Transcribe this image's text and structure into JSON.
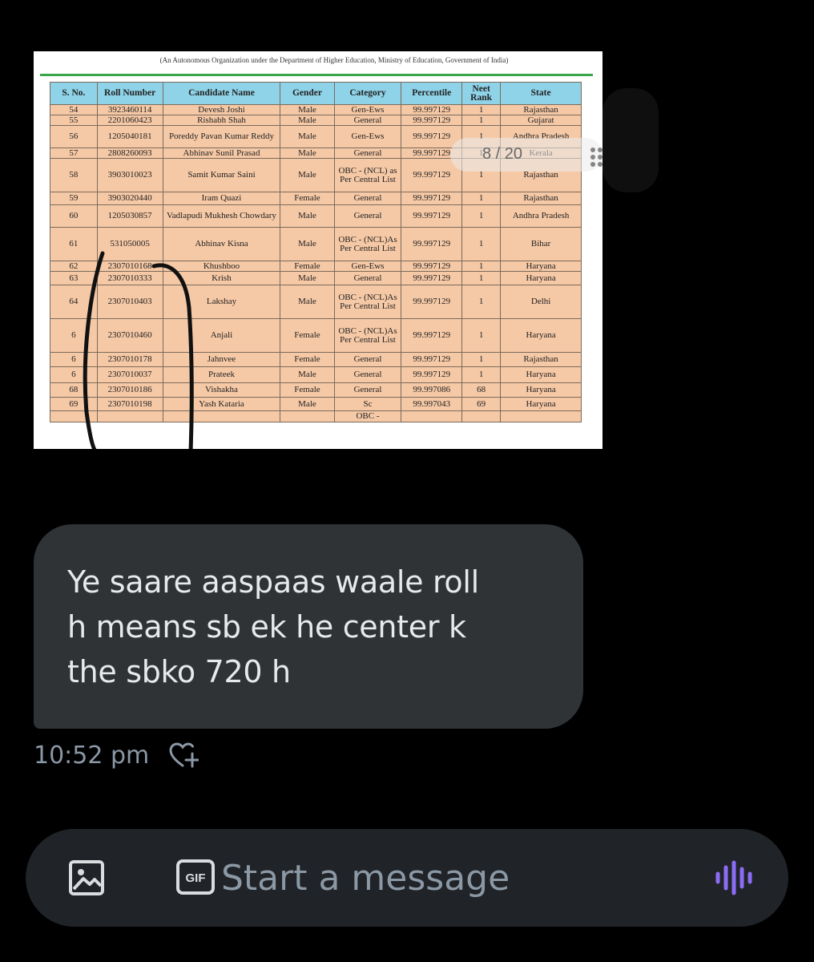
{
  "attachment": {
    "header_text": "(An Autonomous Organization under the Department of Higher Education, Ministry of Education, Government of India)",
    "pager": "8 / 20",
    "table": {
      "headers": [
        "S. No.",
        "Roll Number",
        "Candidate Name",
        "Gender",
        "Category",
        "Percentile",
        "Neet Rank",
        "State"
      ],
      "rows": [
        [
          "54",
          "3923460114",
          "Devesh Joshi",
          "Male",
          "Gen-Ews",
          "99.997129",
          "1",
          "Rajasthan"
        ],
        [
          "55",
          "2201060423",
          "Rishabh Shah",
          "Male",
          "General",
          "99.997129",
          "1",
          "Gujarat"
        ],
        [
          "56",
          "1205040181",
          "Poreddy Pavan Kumar Reddy",
          "Male",
          "Gen-Ews",
          "99.997129",
          "1",
          "Andhra Pradesh"
        ],
        [
          "57",
          "2808260093",
          "Abhinav Sunil Prasad",
          "Male",
          "General",
          "99.997129",
          "1",
          "Kerala"
        ],
        [
          "58",
          "3903010023",
          "Samit Kumar Saini",
          "Male",
          "OBC - (NCL) as Per Central List",
          "99.997129",
          "1",
          "Rajasthan"
        ],
        [
          "59",
          "3903020440",
          "Iram Quazi",
          "Female",
          "General",
          "99.997129",
          "1",
          "Rajasthan"
        ],
        [
          "60",
          "1205030857",
          "Vadlapudi Mukhesh Chowdary",
          "Male",
          "General",
          "99.997129",
          "1",
          "Andhra Pradesh"
        ],
        [
          "61",
          "531050005",
          "Abhinav Kisna",
          "Male",
          "OBC - (NCL)As Per Central List",
          "99.997129",
          "1",
          "Bihar"
        ],
        [
          "62",
          "2307010168",
          "Khushboo",
          "Female",
          "Gen-Ews",
          "99.997129",
          "1",
          "Haryana"
        ],
        [
          "63",
          "2307010333",
          "Krish",
          "Male",
          "General",
          "99.997129",
          "1",
          "Haryana"
        ],
        [
          "64",
          "2307010403",
          "Lakshay",
          "Male",
          "OBC - (NCL)As Per Central List",
          "99.997129",
          "1",
          "Delhi"
        ],
        [
          "6",
          "2307010460",
          "Anjali",
          "Female",
          "OBC - (NCL)As Per Central List",
          "99.997129",
          "1",
          "Haryana"
        ],
        [
          "6",
          "2307010178",
          "Jahnvee",
          "Female",
          "General",
          "99.997129",
          "1",
          "Rajasthan"
        ],
        [
          "6",
          "2307010037",
          "Prateek",
          "Male",
          "General",
          "99.997129",
          "1",
          "Haryana"
        ],
        [
          "68",
          "2307010186",
          "Vishakha",
          "Female",
          "General",
          "99.997086",
          "68",
          "Haryana"
        ],
        [
          "69",
          "2307010198",
          "Yash Kataria",
          "Male",
          "Sc",
          "99.997043",
          "69",
          "Haryana"
        ],
        [
          "",
          "",
          "",
          "",
          "OBC -",
          "",
          "",
          ""
        ]
      ]
    }
  },
  "message": {
    "text_lines": [
      "Ye saare aaspaas waale roll",
      "h means sb ek he center k",
      "the sbko 720 h"
    ],
    "timestamp": "10:52 pm"
  },
  "composer": {
    "placeholder": "Start a message",
    "gif_label": "GIF"
  },
  "colors": {
    "bubble": "#2f3336",
    "composer": "#202327",
    "accent_voice": "#8c6cf4",
    "table_header": "#8fd3e8",
    "table_body": "#f6c9a6"
  }
}
